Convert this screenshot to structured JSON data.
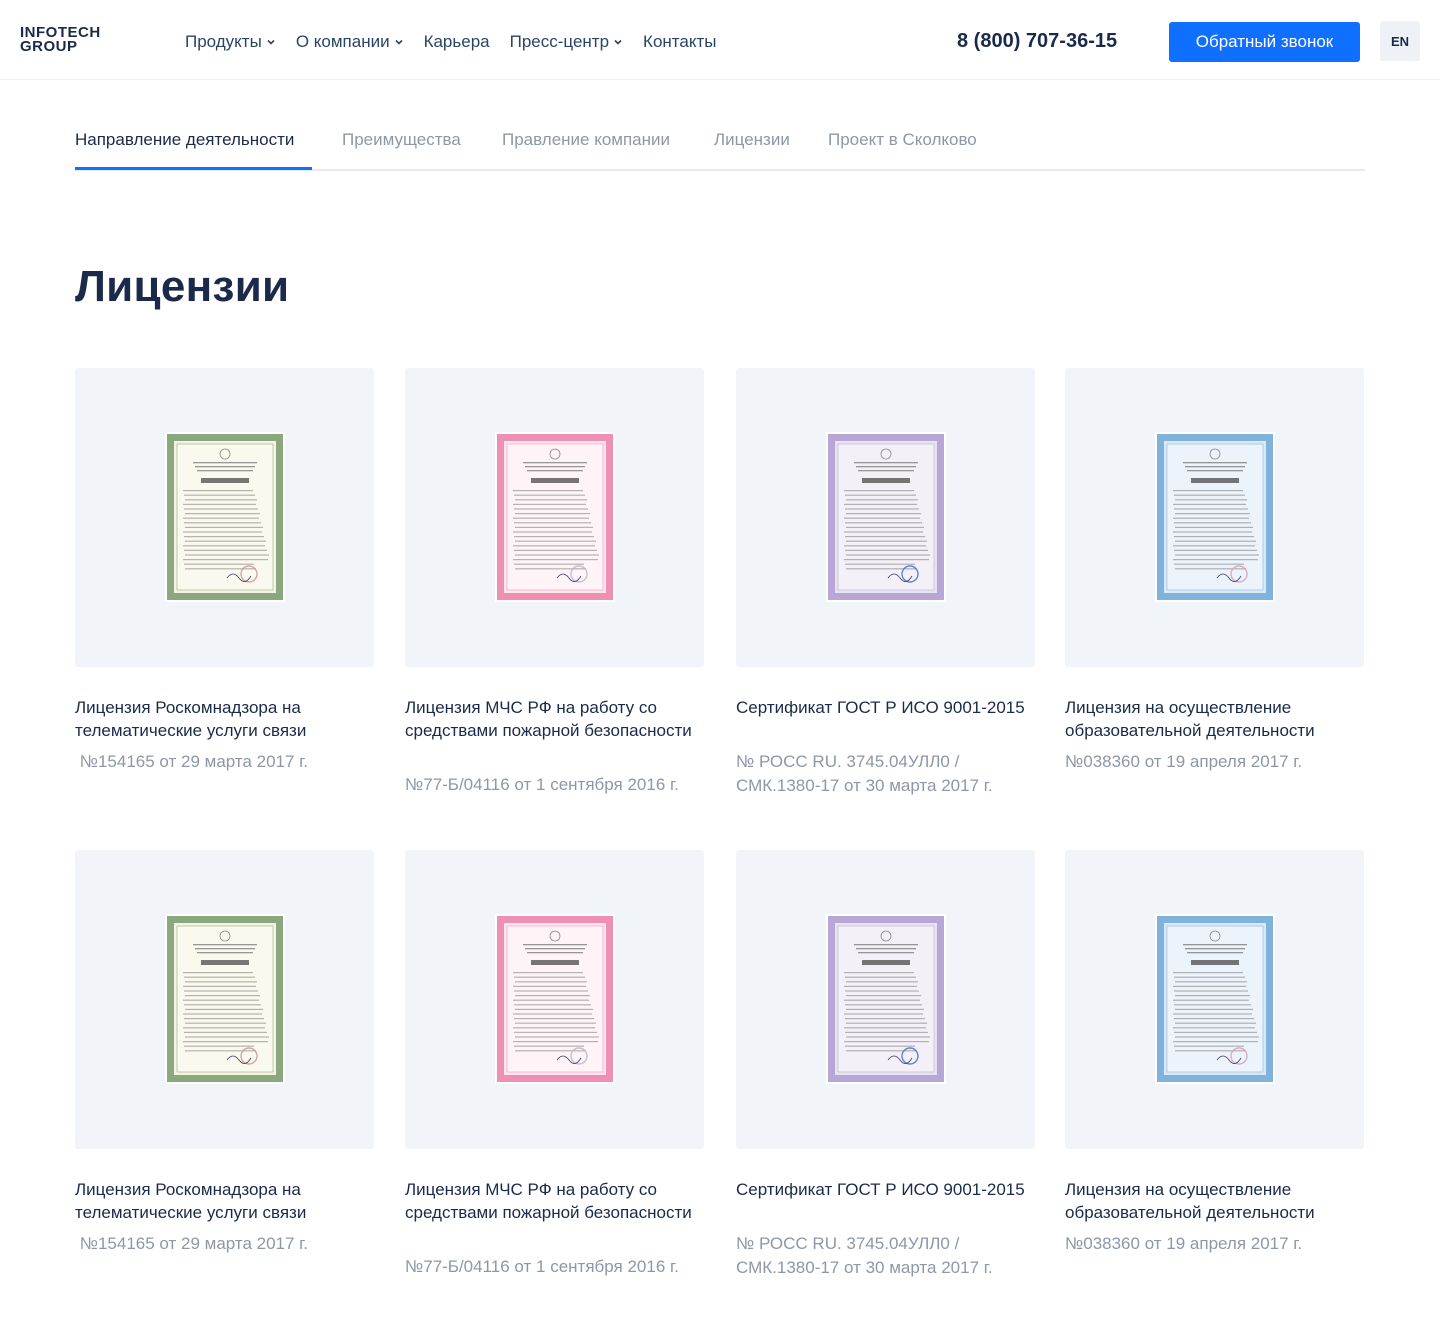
{
  "header": {
    "logo_line1": "INFOTECH",
    "logo_line2": "GROUP",
    "nav": [
      {
        "label": "Продукты",
        "dropdown": true
      },
      {
        "label": "О компании",
        "dropdown": true
      },
      {
        "label": "Карьера",
        "dropdown": false
      },
      {
        "label": "Пресс-центр",
        "dropdown": true
      },
      {
        "label": "Контакты",
        "dropdown": false
      }
    ],
    "phone": "8 (800) 707-36-15",
    "callback_label": "Обратный звонок",
    "lang_label": "EN"
  },
  "tabs": [
    {
      "label": "Направление деятельности",
      "active": true
    },
    {
      "label": "Преимущества",
      "active": false
    },
    {
      "label": "Правление компании",
      "active": false
    },
    {
      "label": "Лицензии",
      "active": false
    },
    {
      "label": "Проект в Сколково",
      "active": false
    }
  ],
  "page_title": "Лицензии",
  "licenses": [
    {
      "title": "Лицензия Роскомнадзора на телематические услуги связи",
      "number": " №154165 от 29 марта 2017 г.",
      "doc_style": "green",
      "doc_header": "ЛИЦЕНЗИЯ"
    },
    {
      "title": "Лицензия МЧС РФ  на работу со средствами пожарной безопасности",
      "number": "№77-Б/04116 от 1 сентября 2016 г.",
      "doc_style": "pink",
      "doc_header": "ЛИЦЕНЗИЯ"
    },
    {
      "title": "Сертификат ГОСТ Р ИСО 9001-2015",
      "number": "№ РОСС RU. 3745.04УЛЛ0 / СМК.1380-17 от 30 марта 2017 г.",
      "doc_style": "violet",
      "doc_header": "Сертификат соответствия"
    },
    {
      "title": "Лицензия на осуществление образовательной деятельности",
      "number": "№038360 от 19 апреля 2017 г.",
      "doc_style": "blue",
      "doc_header": "ЛИЦЕНЗИЯ"
    },
    {
      "title": "Лицензия Роскомнадзора на телематические услуги связи",
      "number": " №154165 от 29 марта 2017 г.",
      "doc_style": "green",
      "doc_header": "ЛИЦЕНЗИЯ"
    },
    {
      "title": "Лицензия МЧС РФ  на работу со средствами пожарной безопасности",
      "number": "№77-Б/04116 от 1 сентября 2016 г.",
      "doc_style": "pink",
      "doc_header": "ЛИЦЕНЗИЯ"
    },
    {
      "title": "Сертификат ГОСТ Р ИСО 9001-2015",
      "number": "№ РОСС RU. 3745.04УЛЛ0 / СМК.1380-17 от 30 марта 2017 г.",
      "doc_style": "violet",
      "doc_header": "Сертификат соответствия"
    },
    {
      "title": "Лицензия на осуществление образовательной деятельности",
      "number": "№038360 от 19 апреля 2017 г.",
      "doc_style": "blue",
      "doc_header": "ЛИЦЕНЗИЯ"
    }
  ],
  "colors": {
    "accent": "#0f6fff",
    "text_dark": "#1b2a4a",
    "text_muted": "#8d97a8",
    "card_bg": "#f1f4f9",
    "doc_green": "#8aa77e",
    "doc_pink": "#ef8fb4",
    "doc_violet": "#b7a6d6",
    "doc_blue": "#7fb3dc"
  }
}
